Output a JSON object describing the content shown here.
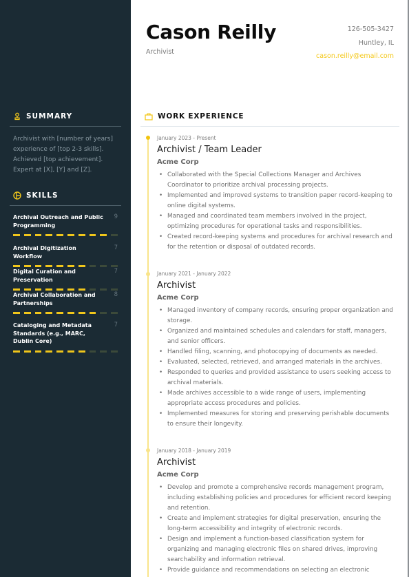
{
  "header": {
    "name": "Cason Reilly",
    "role": "Archivist",
    "phone": "126-505-3427",
    "location": "Huntley, IL",
    "email": "cason.reilly@email.com"
  },
  "colors": {
    "accent": "#f2c40f",
    "sidebar_bg": "#1b2b34"
  },
  "sidebar": {
    "summary": {
      "icon": "person-icon",
      "heading": "SUMMARY",
      "text": "Archivist with [number of years] experience of [top 2-3 skills]. Achieved [top achievement]. Expert at [X], [Y] and [Z]."
    },
    "skills": {
      "icon": "pie-icon",
      "heading": "SKILLS",
      "max": 10,
      "items": [
        {
          "name": "Archival Outreach and Public Programming",
          "score": 9
        },
        {
          "name": "Archival Digitization Workflow",
          "score": 7
        },
        {
          "name": "Digital Curation and Preservation",
          "score": 7
        },
        {
          "name": "Archival Collaboration and Partnerships",
          "score": 8
        },
        {
          "name": "Cataloging and Metadata Standards (e.g., MARC, Dublin Core)",
          "score": 7
        }
      ]
    }
  },
  "experience": {
    "icon": "briefcase-icon",
    "heading": "WORK EXPERIENCE",
    "jobs": [
      {
        "date": "January 2023 - Present",
        "title": "Archivist / Team Leader",
        "company": "Acme Corp",
        "bullets": [
          "Collaborated with the Special Collections Manager and Archives Coordinator to prioritize archival processing projects.",
          "Implemented and improved systems to transition paper record-keeping to online digital systems.",
          "Managed and coordinated team members involved in the project, optimizing procedures for operational tasks and responsibilities.",
          "Created record-keeping systems and procedures for archival research and for the retention or disposal of outdated records."
        ]
      },
      {
        "date": "January 2021 - January 2022",
        "title": "Archivist",
        "company": "Acme Corp",
        "bullets": [
          "Managed inventory of company records, ensuring proper organization and storage.",
          "Organized and maintained schedules and calendars for staff, managers, and senior officers.",
          "Handled filing, scanning, and photocopying of documents as needed.",
          "Evaluated, selected, retrieved, and arranged materials in the archives.",
          "Responded to queries and provided assistance to users seeking access to archival materials.",
          "Made archives accessible to a wide range of users, implementing appropriate access procedures and policies.",
          "Implemented measures for storing and preserving perishable documents to ensure their longevity."
        ]
      },
      {
        "date": "January 2018 - January 2019",
        "title": "Archivist",
        "company": "Acme Corp",
        "bullets": [
          "Develop and promote a comprehensive records management program, including establishing policies and procedures for efficient record keeping and retention.",
          "Create and implement strategies for digital preservation, ensuring the long-term accessibility and integrity of electronic records.",
          "Design and implement a function-based classification system for organizing and managing electronic files on shared drives, improving searchability and information retrieval.",
          "Provide guidance and recommendations on selecting an electronic"
        ]
      }
    ]
  }
}
